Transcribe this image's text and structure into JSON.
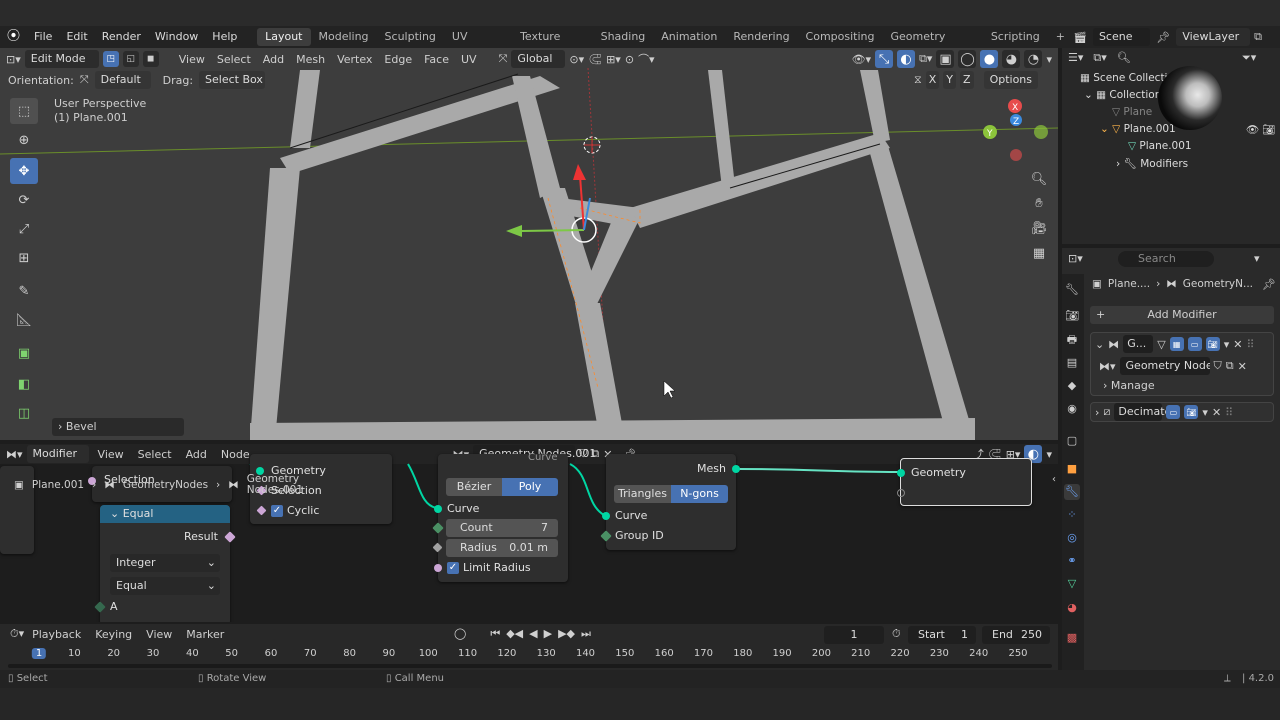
{
  "menus": [
    "File",
    "Edit",
    "Render",
    "Window",
    "Help"
  ],
  "workspaces": [
    "Layout",
    "Modeling",
    "Sculpting",
    "UV Editing",
    "Texture Paint",
    "Shading",
    "Animation",
    "Rendering",
    "Compositing",
    "Geometry Nodes",
    "Scripting"
  ],
  "active_workspace": "Layout",
  "scene_name": "Scene",
  "view_layer": "ViewLayer",
  "viewport": {
    "mode": "Edit Mode",
    "header_menus": [
      "View",
      "Select",
      "Add",
      "Mesh",
      "Vertex",
      "Edge",
      "Face",
      "UV"
    ],
    "transform_orientation": "Global",
    "orientation_label": "Orientation:",
    "orientation_value": "Default",
    "drag_label": "Drag:",
    "drag_value": "Select Box",
    "axis_x": "X",
    "axis_y": "Y",
    "axis_z": "Z",
    "options": "Options",
    "view_name": "User Perspective",
    "object_name": "(1) Plane.001",
    "last_op": "Bevel",
    "gizmo": {
      "x": "X",
      "y": "Y",
      "z": "Z"
    }
  },
  "outliner": {
    "scene_collection": "Scene Collection",
    "collection": "Collection",
    "items": [
      "Plane",
      "Plane.001",
      "Plane.001",
      "Modifiers"
    ]
  },
  "properties": {
    "search_placeholder": "Search",
    "breadcrumb_object": "Plane....",
    "breadcrumb_modifier": "GeometryN...",
    "add_modifier": "Add Modifier",
    "modifier1_name": "G...",
    "node_group": "Geometry Nodes....",
    "manage": "Manage",
    "modifier2_name": "Decimate"
  },
  "node_editor": {
    "editor_type": "Modifier",
    "menus": [
      "View",
      "Select",
      "Add",
      "Node"
    ],
    "node_group": "Geometry Nodes.001",
    "breadcrumb": [
      "Plane.001",
      "GeometryNodes",
      "Geometry Nodes.001"
    ],
    "nodes": {
      "equal": {
        "title": "Equal",
        "output": "Result",
        "type": "Integer",
        "op": "Equal",
        "input_a": "A"
      },
      "selection_partial": {
        "label": "Selection"
      },
      "sep": {
        "geometry": "Geometry",
        "selection": "Selection",
        "cyclic": "Cyclic"
      },
      "fillet": {
        "header_partial": "Curve",
        "mode_a": "Bézier",
        "mode_b": "Poly",
        "curve": "Curve",
        "count_label": "Count",
        "count": "7",
        "radius_label": "Radius",
        "radius": "0.01 m",
        "limit_radius": "Limit Radius"
      },
      "fill": {
        "mesh": "Mesh",
        "mode_a": "Triangles",
        "mode_b": "N-gons",
        "curve": "Curve",
        "group_id": "Group ID"
      },
      "group_output": {
        "geometry": "Geometry"
      }
    }
  },
  "timeline": {
    "menus": [
      "Playback",
      "Keying",
      "View",
      "Marker"
    ],
    "current_frame": "1",
    "start_label": "Start",
    "start": "1",
    "end_label": "End",
    "end": "250",
    "ticks": [
      "1",
      "10",
      "20",
      "30",
      "40",
      "50",
      "60",
      "70",
      "80",
      "90",
      "100",
      "110",
      "120",
      "130",
      "140",
      "150",
      "160",
      "170",
      "180",
      "190",
      "200",
      "210",
      "220",
      "230",
      "240",
      "250"
    ]
  },
  "status_bar": {
    "select": "Select",
    "rotate": "Rotate View",
    "menu": "Call Menu",
    "version": "4.2.0"
  }
}
